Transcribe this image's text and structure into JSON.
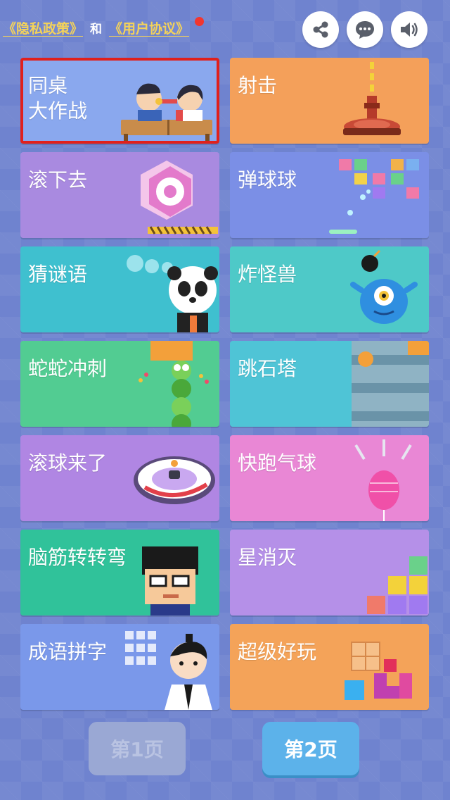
{
  "header": {
    "privacy_link": "《隐私政策》",
    "and_text": "和",
    "agreement_link": "《用户协议》"
  },
  "icons": {
    "share": "share-icon",
    "chat": "chat-icon",
    "sound": "speaker-icon"
  },
  "games": [
    {
      "line1": "同桌",
      "line2": "大作战",
      "color": "#8aa8ee",
      "selected": true
    },
    {
      "line1": "射击",
      "line2": "",
      "color": "#f4a05a"
    },
    {
      "line1": "滚下去",
      "line2": "",
      "color": "#a98ae0"
    },
    {
      "line1": "弹球球",
      "line2": "",
      "color": "#7b8fe6"
    },
    {
      "line1": "猜谜语",
      "line2": "",
      "color": "#3fc0cf"
    },
    {
      "line1": "炸怪兽",
      "line2": "",
      "color": "#4ec9c8"
    },
    {
      "line1": "蛇蛇冲刺",
      "line2": "",
      "color": "#52cc92"
    },
    {
      "line1": "跳石塔",
      "line2": "",
      "color": "#4fc4d6"
    },
    {
      "line1": "滚球来了",
      "line2": "",
      "color": "#b086e3"
    },
    {
      "line1": "快跑气球",
      "line2": "",
      "color": "#e987d5"
    },
    {
      "line1": "脑筋转转弯",
      "line2": "",
      "color": "#30c29a"
    },
    {
      "line1": "星消灭",
      "line2": "",
      "color": "#b590e8"
    },
    {
      "line1": "成语拼字",
      "line2": "",
      "color": "#7a98ea"
    },
    {
      "line1": "超级好玩",
      "line2": "",
      "color": "#f4a359"
    }
  ],
  "pager": {
    "prev_label": "第1页",
    "next_label": "第2页"
  }
}
